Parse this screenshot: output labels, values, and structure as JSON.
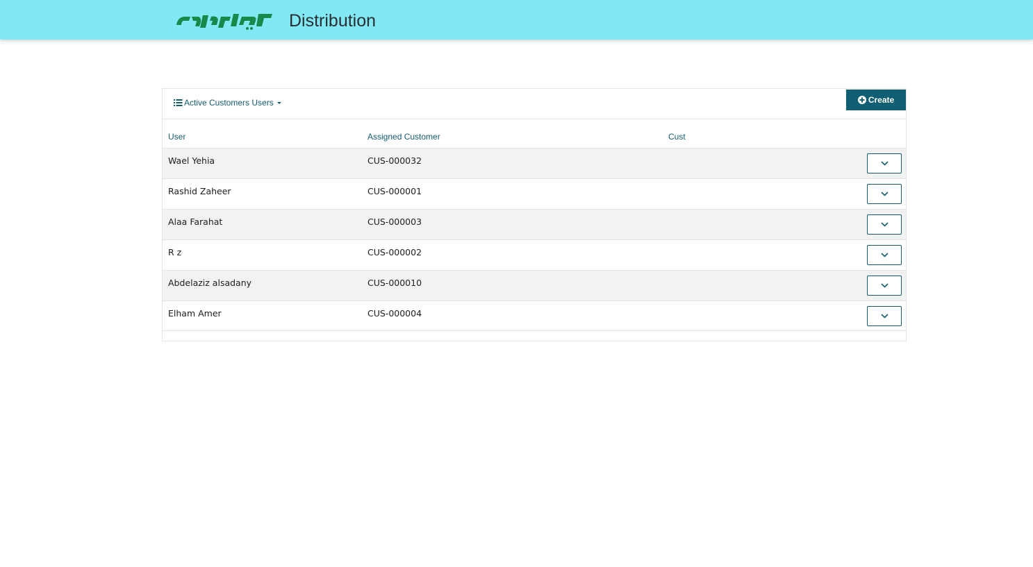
{
  "header": {
    "app_title": "Distribution",
    "logo_icon": "brand-logo-arabic-wordmark",
    "background_color": "#82e8f4",
    "logo_color": "#17894a"
  },
  "toolbar": {
    "view_label": "Active Customers Users",
    "view_icon": "list-icon",
    "create_label": "Create",
    "create_icon": "plus-circle-icon",
    "accent_color": "#0f5e72"
  },
  "table": {
    "columns": [
      "User",
      "Assigned Customer",
      "Cust"
    ],
    "row_action_icon": "chevron-down-icon",
    "rows": [
      {
        "user": "Wael Yehia",
        "customer": "CUS-000032",
        "cust": ""
      },
      {
        "user": "Rashid Zaheer",
        "customer": "CUS-000001",
        "cust": ""
      },
      {
        "user": "Alaa Farahat",
        "customer": "CUS-000003",
        "cust": ""
      },
      {
        "user": "R z",
        "customer": "CUS-000002",
        "cust": ""
      },
      {
        "user": "Abdelaziz alsadany",
        "customer": "CUS-000010",
        "cust": ""
      },
      {
        "user": "Elham Amer",
        "customer": "CUS-000004",
        "cust": ""
      }
    ]
  }
}
